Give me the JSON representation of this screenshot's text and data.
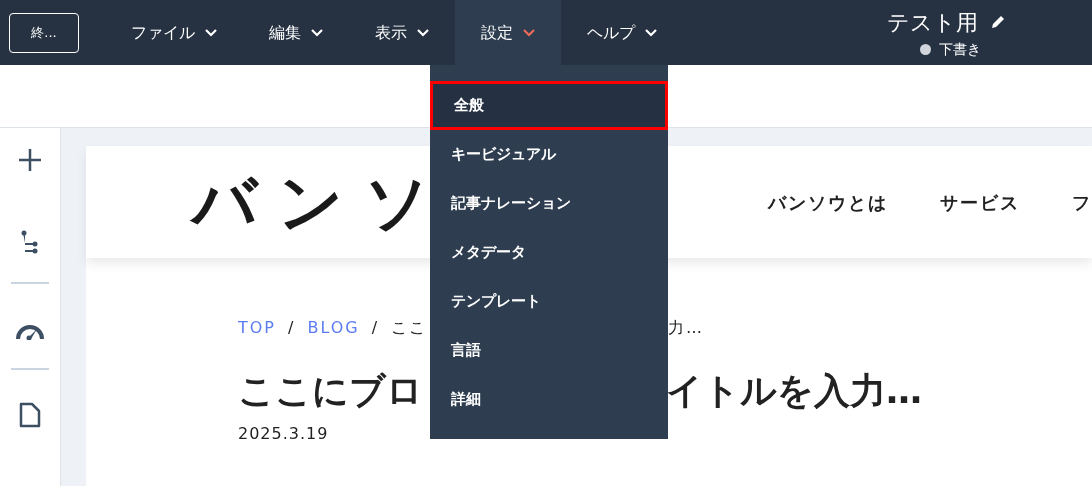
{
  "toolbar": {
    "exit_button": "終...",
    "menus": [
      {
        "label": "ファイル",
        "selected": false
      },
      {
        "label": "編集",
        "selected": false
      },
      {
        "label": "表示",
        "selected": false
      },
      {
        "label": "設定",
        "selected": true
      },
      {
        "label": "ヘルプ",
        "selected": false
      }
    ],
    "document_title": "テスト用",
    "status": "下書き"
  },
  "dropdown": {
    "items": [
      {
        "label": "全般",
        "selected": true
      },
      {
        "label": "キービジュアル",
        "selected": false
      },
      {
        "label": "記事ナレーション",
        "selected": false
      },
      {
        "label": "メタデータ",
        "selected": false
      },
      {
        "label": "テンプレート",
        "selected": false
      },
      {
        "label": "言語",
        "selected": false
      },
      {
        "label": "詳細",
        "selected": false
      }
    ]
  },
  "preview": {
    "logo": "バンソ",
    "nav": [
      "バンソウとは",
      "サービス",
      "フ"
    ],
    "breadcrumb": {
      "links": [
        "TOP",
        "BLOG"
      ],
      "separators": [
        "/",
        "/"
      ],
      "current_visible_start": "ここ",
      "current_visible_end": "力…"
    },
    "title_visible_start": "ここにブロ",
    "title_visible_end": "イトルを入力…",
    "date": "2025.3.19"
  }
}
